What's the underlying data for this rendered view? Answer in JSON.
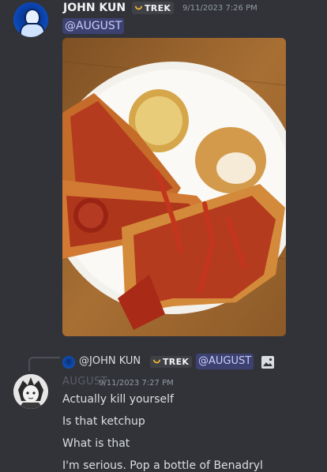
{
  "message1": {
    "author": "JOHN KUN",
    "tag": "TREK",
    "timestamp": "9/11/2023 7:26 PM",
    "mention": "@AUGUST"
  },
  "message2": {
    "reply": {
      "author": "@JOHN KUN",
      "tag": "TREK",
      "mention": "@AUGUST"
    },
    "author": "AUGUST",
    "timestamp": "9/11/2023 7:27 PM",
    "lines": [
      "Actually kill yourself",
      "Is that ketchup",
      "What is that",
      "I'm serious. Pop a bottle of Benadryl"
    ]
  },
  "icons": {
    "avatar": "avatar-icon",
    "tag": "clan-tag-icon",
    "image": "image-icon"
  },
  "colors": {
    "background": "#313338",
    "mention_bg": "#5865F2",
    "text": "#dbdee1"
  }
}
